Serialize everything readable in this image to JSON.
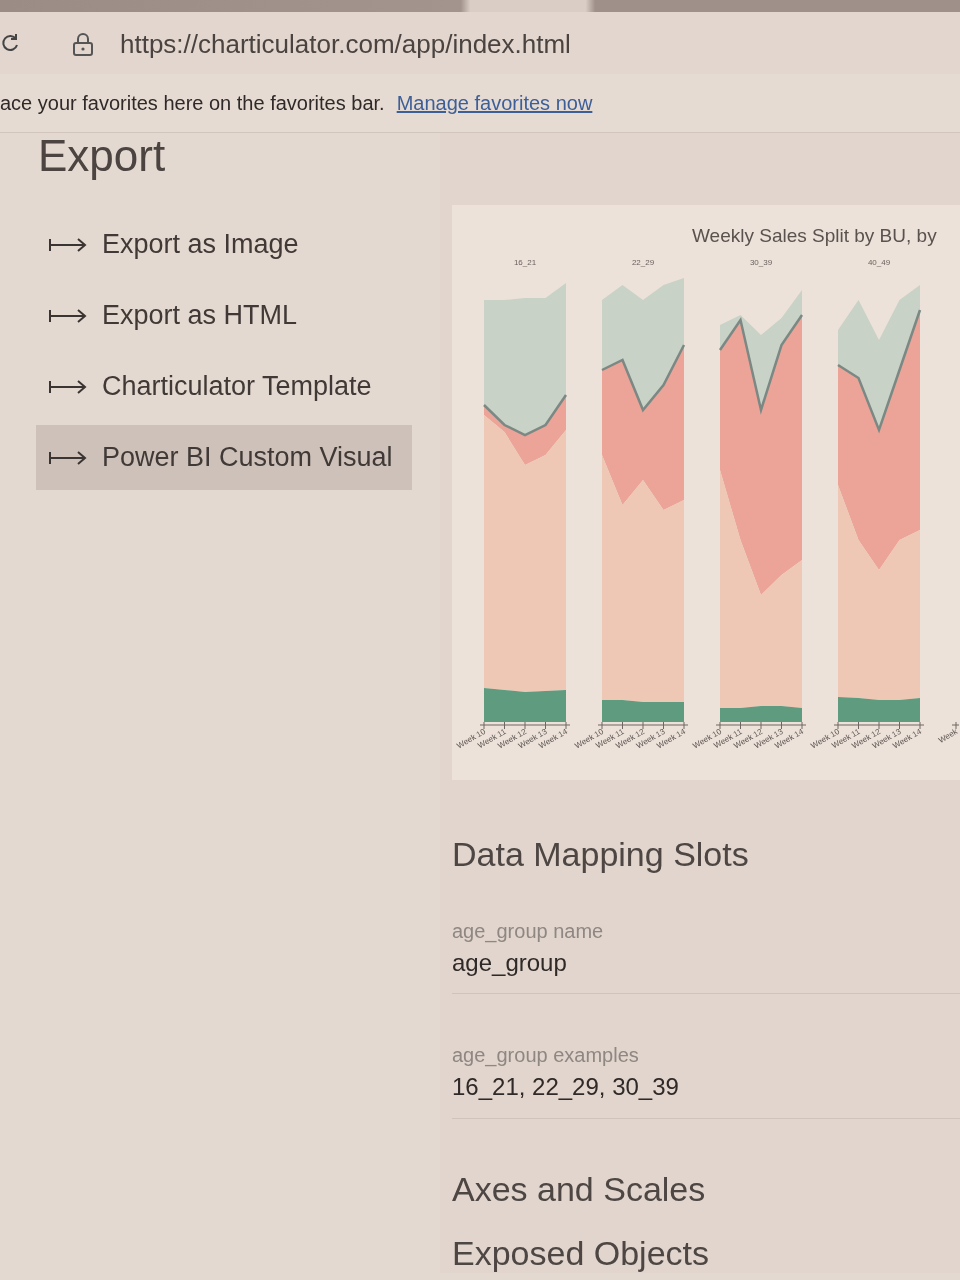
{
  "browser": {
    "url": "https://charticulator.com/app/index.html"
  },
  "favorites_bar": {
    "message": "ace your favorites here on the favorites bar.",
    "link": "Manage favorites now"
  },
  "panel": {
    "title": "Export"
  },
  "export_options": [
    {
      "label": "Export as Image",
      "selected": false
    },
    {
      "label": "Export as HTML",
      "selected": false
    },
    {
      "label": "Charticulator Template",
      "selected": false
    },
    {
      "label": "Power BI Custom Visual",
      "selected": true
    }
  ],
  "preview": {
    "title": "Weekly Sales Split by BU, by",
    "panels": [
      {
        "label": "16_21",
        "x_labels": [
          "Week 10",
          "Week 11",
          "Week 12",
          "Week 13",
          "Week 14"
        ]
      },
      {
        "label": "22_29",
        "x_labels": [
          "Week 10",
          "Week 11",
          "Week 12",
          "Week 13",
          "Week 14"
        ]
      },
      {
        "label": "30_39",
        "x_labels": [
          "Week 10",
          "Week 11",
          "Week 12",
          "Week 13",
          "Week 14"
        ]
      },
      {
        "label": "40_49",
        "x_labels": [
          "Week 10",
          "Week 11",
          "Week 12",
          "Week 13",
          "Week 14"
        ]
      },
      {
        "x_labels": [
          "Week"
        ]
      }
    ]
  },
  "data_mapping": {
    "title": "Data Mapping Slots",
    "fields": [
      {
        "label": "age_group name",
        "value": "age_group"
      },
      {
        "label": "age_group examples",
        "value": "16_21, 22_29, 30_39"
      }
    ]
  },
  "sections": [
    "Axes and Scales",
    "Exposed Objects"
  ]
}
